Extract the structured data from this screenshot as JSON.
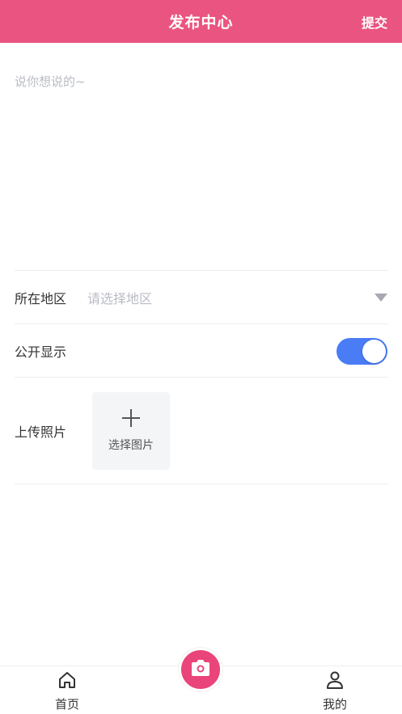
{
  "header": {
    "title": "发布中心",
    "submit_label": "提交",
    "background": "#ea5480"
  },
  "content": {
    "placeholder": "说你想说的~",
    "value": ""
  },
  "form": {
    "region": {
      "label": "所在地区",
      "placeholder": "请选择地区"
    },
    "public": {
      "label": "公开显示",
      "enabled": true,
      "toggle_color": "#4a7cf6"
    },
    "upload": {
      "label": "上传照片",
      "button_text": "选择图片"
    }
  },
  "tabbar": {
    "home_label": "首页",
    "mine_label": "我的",
    "center_icon": "camera-icon",
    "center_color": "#e9457a"
  }
}
